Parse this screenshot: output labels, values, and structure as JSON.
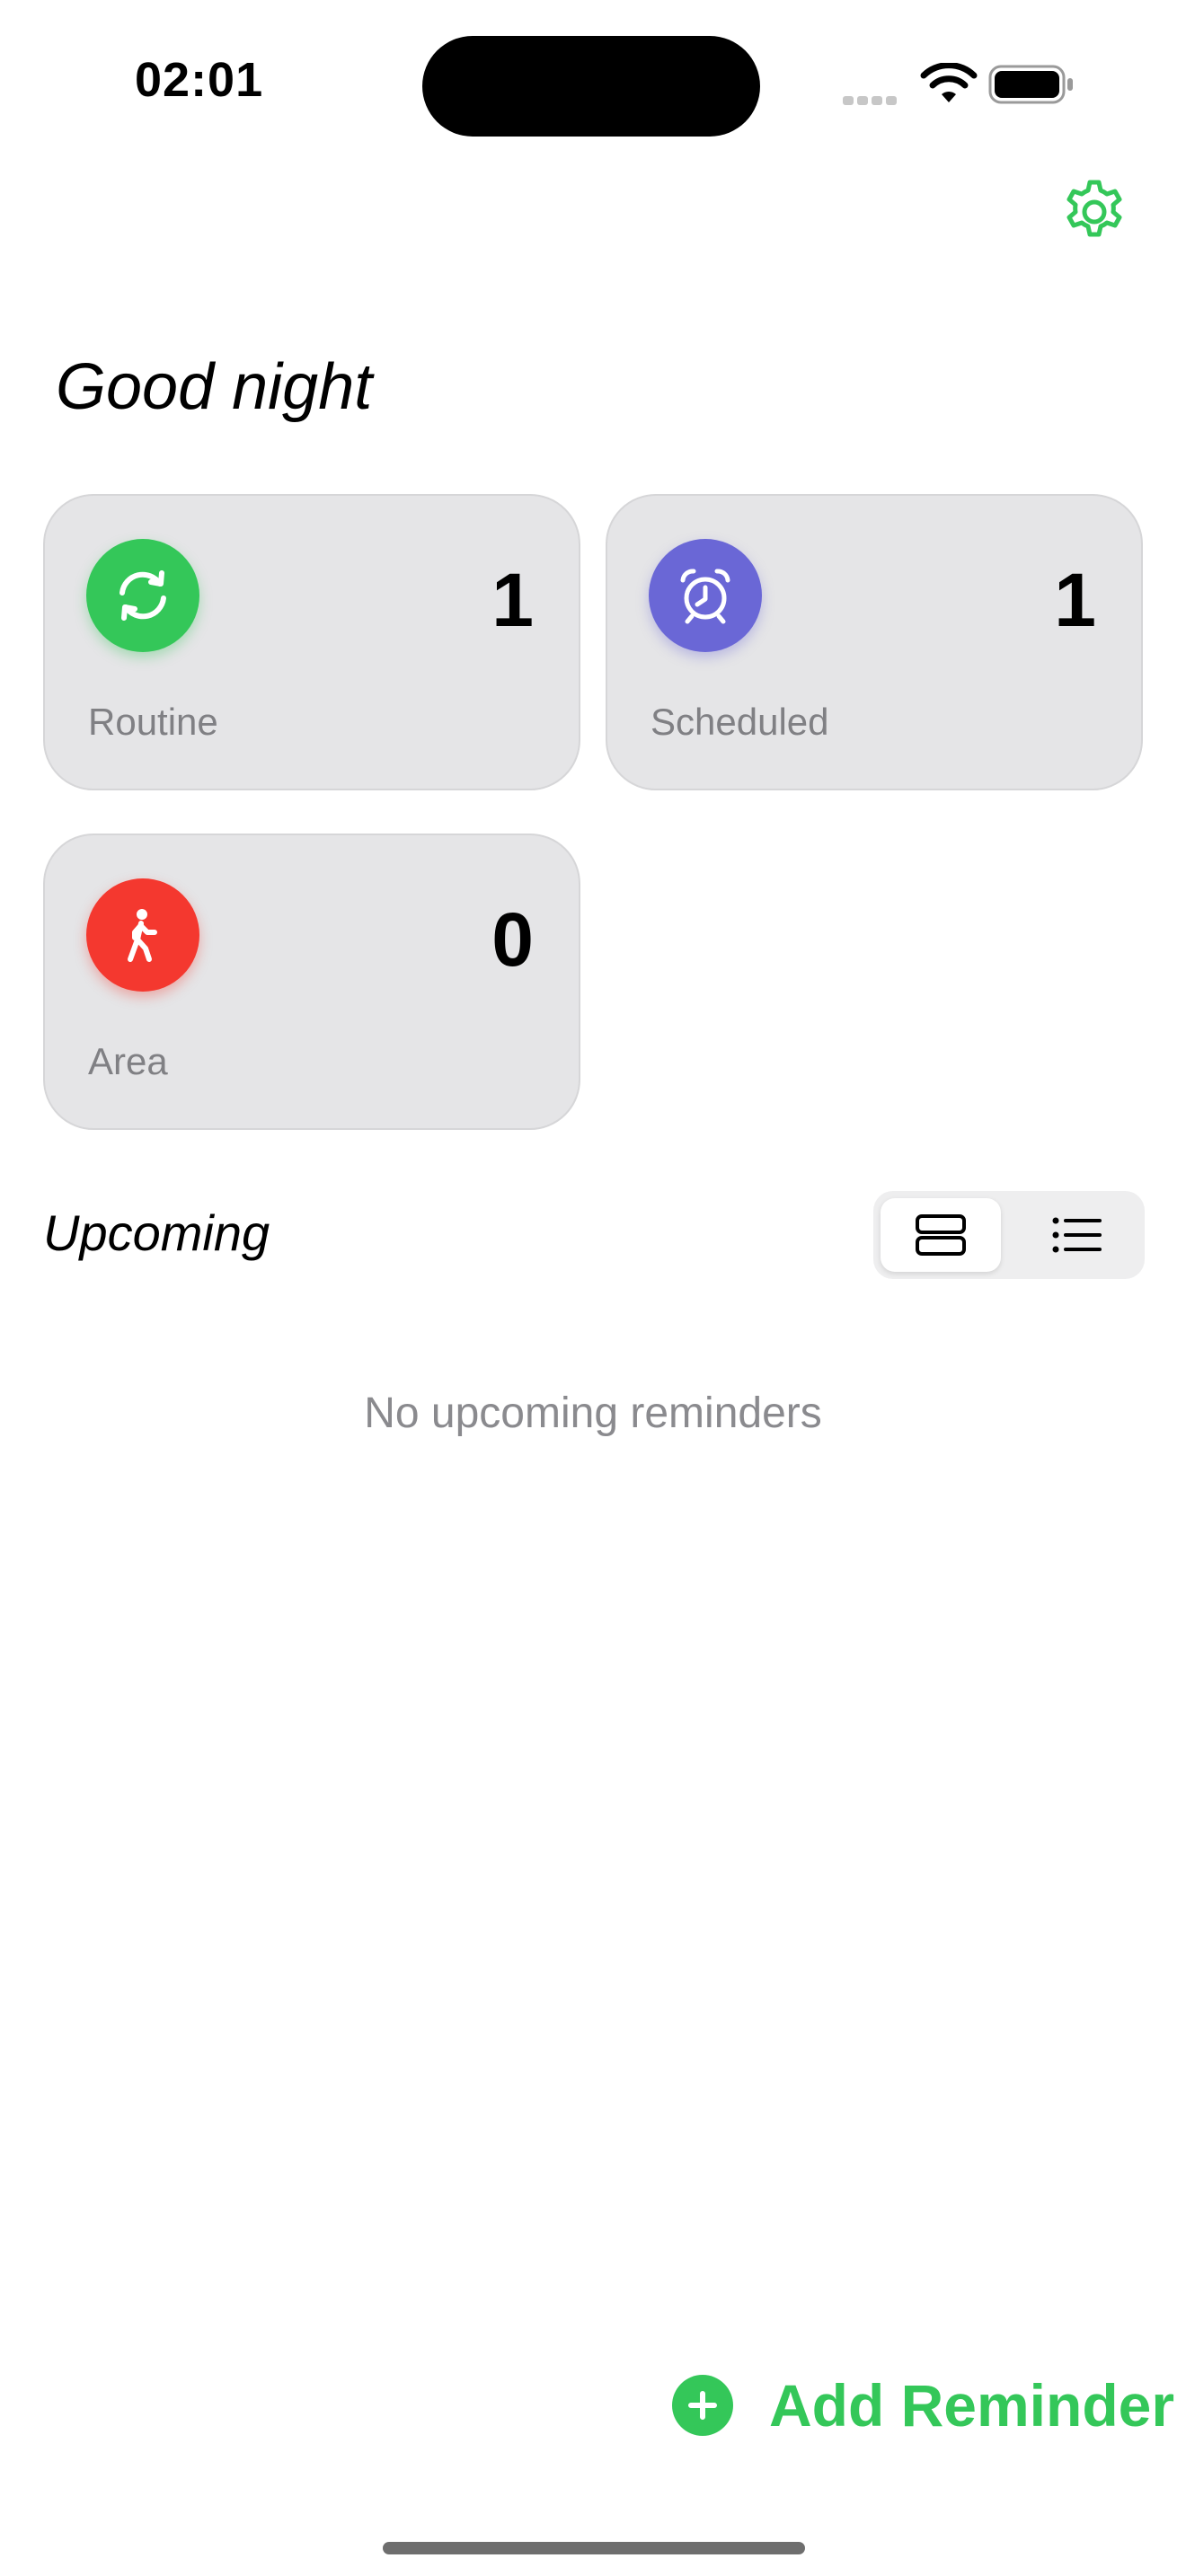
{
  "status_bar": {
    "time": "02:01"
  },
  "header": {
    "settings_icon": "gear-icon",
    "greeting": "Good night"
  },
  "colors": {
    "accent": "#34c759",
    "routine": "#34c759",
    "scheduled": "#6a67d6",
    "area": "#f4382f"
  },
  "cards": {
    "routine": {
      "icon": "arrows-cycle-icon",
      "count": "1",
      "label": "Routine"
    },
    "scheduled": {
      "icon": "alarm-clock-icon",
      "count": "1",
      "label": "Scheduled"
    },
    "area": {
      "icon": "walking-person-icon",
      "count": "0",
      "label": "Area"
    }
  },
  "upcoming": {
    "title": "Upcoming",
    "toggle": [
      "card-view-icon",
      "list-view-icon"
    ],
    "selected_view": "card-view",
    "empty_message": "No upcoming reminders"
  },
  "footer": {
    "add_label": "Add Reminder",
    "add_icon": "plus-circle-icon"
  }
}
